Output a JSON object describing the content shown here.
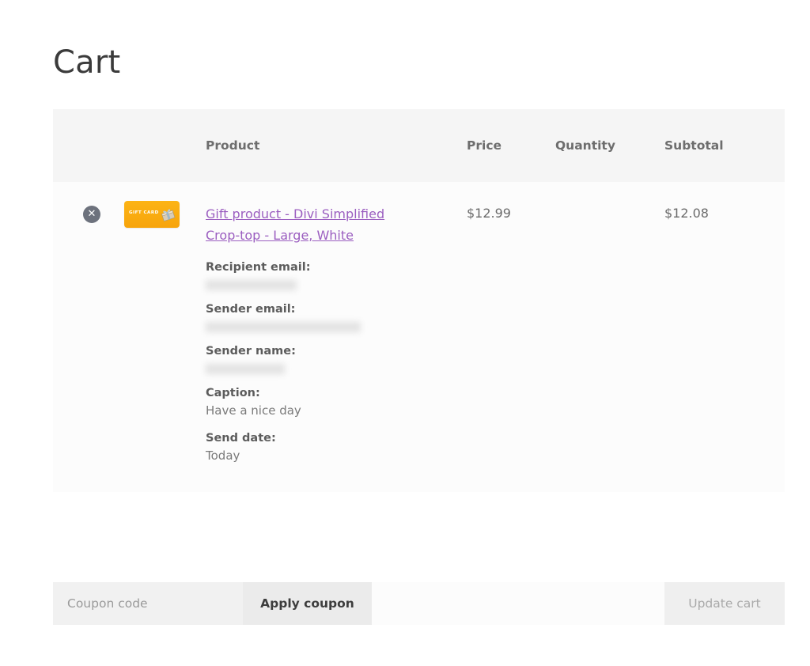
{
  "page": {
    "title": "Cart"
  },
  "colors": {
    "link": "#9b5ec0",
    "thumb_accent": "#f7a40c",
    "remove_button": "#6d727d",
    "header_bg": "#f5f5f5",
    "row_bg": "#fcfcfc"
  },
  "table": {
    "headers": {
      "remove": "",
      "thumbnail": "",
      "product": "Product",
      "price": "Price",
      "quantity": "Quantity",
      "subtotal": "Subtotal"
    },
    "rows": [
      {
        "remove_label": "✕",
        "thumbnail": {
          "label": "GIFT CARD",
          "icon": "gift-box-icon"
        },
        "product_name": "Gift product - Divi Simplified Crop-top - Large, White",
        "meta": [
          {
            "label": "Recipient email:",
            "value": "",
            "redacted": true,
            "width_class": "redact-w1"
          },
          {
            "label": "Sender email:",
            "value": "",
            "redacted": true,
            "width_class": "redact-w2"
          },
          {
            "label": "Sender name:",
            "value": "",
            "redacted": true,
            "width_class": "redact-w3"
          },
          {
            "label": "Caption:",
            "value": "Have a nice day",
            "redacted": false,
            "width_class": ""
          },
          {
            "label": "Send date:",
            "value": "Today",
            "redacted": false,
            "width_class": ""
          }
        ],
        "price": "$12.99",
        "quantity": "",
        "subtotal": "$12.08"
      }
    ]
  },
  "coupon": {
    "input_value": "",
    "input_placeholder": "Coupon code",
    "apply_label": "Apply coupon",
    "update_label": "Update cart"
  }
}
